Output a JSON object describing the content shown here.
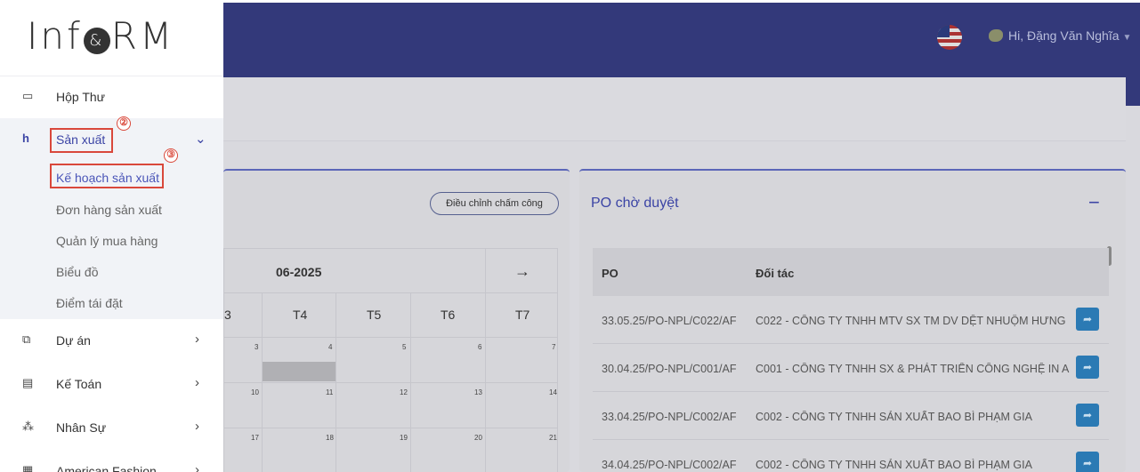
{
  "header": {
    "greeting": "Hi, Đặng Văn Nghĩa"
  },
  "calendar": {
    "adjust_button": "Điều chỉnh chấm công",
    "month": "06-2025",
    "next_arrow": "→",
    "days": [
      "3",
      "T4",
      "T5",
      "T6",
      "T7"
    ],
    "rows": [
      [
        "3",
        "4",
        "5",
        "6",
        "7"
      ],
      [
        "10",
        "11",
        "12",
        "13",
        "14"
      ],
      [
        "17",
        "18",
        "19",
        "20",
        "21"
      ]
    ]
  },
  "po_panel": {
    "title": "PO chờ duyệt",
    "collapse": "−",
    "columns": [
      "PO",
      "Đối tác"
    ],
    "rows": [
      {
        "po": "33.05.25/PO-NPL/C022/AF",
        "partner": "C022 - CÔNG TY TNHH MTV SX TM DV DỆT NHUỘM HƯNG"
      },
      {
        "po": "30.04.25/PO-NPL/C001/AF",
        "partner": "C001 - CÔNG TY TNHH SX & PHÁT TRIỂN CÔNG NGHỆ IN A"
      },
      {
        "po": "33.04.25/PO-NPL/C002/AF",
        "partner": "C002 - CÔNG TY TNHH SẢN XUẤT BAO BÌ PHẠM GIA"
      },
      {
        "po": "34.04.25/PO-NPL/C002/AF",
        "partner": "C002 - CÔNG TY TNHH SẢN XUẤT BAO BÌ PHẠM GIA"
      }
    ]
  },
  "sidebar": {
    "logo_left": "Inf",
    "logo_amp": "&",
    "logo_right": "RM",
    "items": [
      {
        "label": "Hộp Thư",
        "icon": "inbox-icon"
      },
      {
        "label": "Sản xuất",
        "icon": "factory-icon"
      },
      {
        "label": "Dự án",
        "icon": "project-icon"
      },
      {
        "label": "Kế Toán",
        "icon": "accounting-icon"
      },
      {
        "label": "Nhân Sự",
        "icon": "users-icon"
      },
      {
        "label": "American Fashion",
        "icon": "building-icon"
      }
    ],
    "submenu": [
      "Kế hoạch sản xuất",
      "Đơn hàng sản xuất",
      "Quản lý mua hàng",
      "Biểu đồ",
      "Điểm tái đặt"
    ],
    "markers": [
      "②",
      "③"
    ]
  },
  "colors": {
    "header_bg": "#33397a",
    "highlight": "#d9483b",
    "primary": "#3b44a5",
    "action": "#2b7ab4"
  }
}
